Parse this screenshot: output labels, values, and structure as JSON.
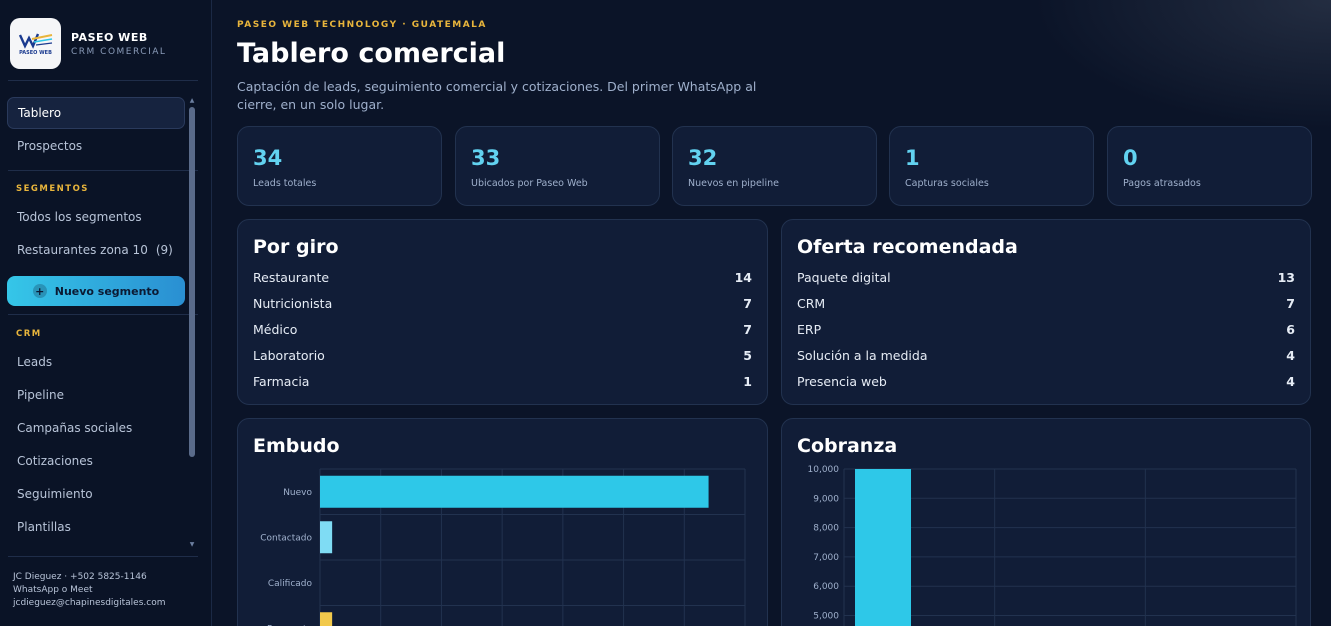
{
  "brand": {
    "name": "PASEO WEB",
    "subtitle": "CRM COMERCIAL",
    "logo_text": "PASEO WEB"
  },
  "sidebar": {
    "items_top": [
      {
        "label": "Tablero",
        "active": true
      },
      {
        "label": "Prospectos",
        "active": false
      }
    ],
    "segments_title": "SEGMENTOS",
    "segments": [
      {
        "label": "Todos los segmentos",
        "count": ""
      },
      {
        "label": "Restaurantes zona 10",
        "count": "(9)"
      }
    ],
    "new_segment_label": "Nuevo segmento",
    "crm_title": "CRM",
    "crm_items": [
      "Leads",
      "Pipeline",
      "Campañas sociales",
      "Cotizaciones",
      "Seguimiento",
      "Plantillas"
    ],
    "contact": {
      "line1": "JC Dieguez · +502 5825-1146",
      "line2": "WhatsApp o Meet",
      "line3": "jcdieguez@chapinesdigitales.com"
    }
  },
  "header": {
    "eyebrow": "PASEO WEB TECHNOLOGY · GUATEMALA",
    "title": "Tablero comercial",
    "description": "Captación de leads, seguimiento comercial y cotizaciones. Del primer WhatsApp al cierre, en un solo lugar."
  },
  "stats": [
    {
      "value": "34",
      "label": "Leads totales"
    },
    {
      "value": "33",
      "label": "Ubicados por Paseo Web"
    },
    {
      "value": "32",
      "label": "Nuevos en pipeline"
    },
    {
      "value": "1",
      "label": "Capturas sociales"
    },
    {
      "value": "0",
      "label": "Pagos atrasados"
    }
  ],
  "por_giro": {
    "title": "Por giro",
    "rows": [
      {
        "label": "Restaurante",
        "value": "14"
      },
      {
        "label": "Nutricionista",
        "value": "7"
      },
      {
        "label": "Médico",
        "value": "7"
      },
      {
        "label": "Laboratorio",
        "value": "5"
      },
      {
        "label": "Farmacia",
        "value": "1"
      }
    ]
  },
  "oferta": {
    "title": "Oferta recomendada",
    "rows": [
      {
        "label": "Paquete digital",
        "value": "13"
      },
      {
        "label": "CRM",
        "value": "7"
      },
      {
        "label": "ERP",
        "value": "6"
      },
      {
        "label": "Solución a la medida",
        "value": "4"
      },
      {
        "label": "Presencia web",
        "value": "4"
      }
    ]
  },
  "colors": {
    "accent": "#2ec8e8",
    "gold": "#e8b53c",
    "panel": "#111d37",
    "bg": "#0b1428"
  },
  "chart_data": [
    {
      "type": "bar",
      "orientation": "horizontal",
      "title": "Embudo",
      "categories": [
        "Nuevo",
        "Contactado",
        "Calificado",
        "Propuesta"
      ],
      "values": [
        32,
        1,
        0,
        1
      ],
      "colors": [
        "#2ec8e8",
        "#7fdcf4",
        "#2ec8e8",
        "#f2c94c"
      ],
      "xlim": [
        0,
        35
      ],
      "grid": true
    },
    {
      "type": "bar",
      "title": "Cobranza",
      "categories": [
        "",
        "",
        ""
      ],
      "values": [
        10000,
        0,
        0
      ],
      "yticks": [
        "10,000",
        "9,000",
        "8,000",
        "7,000",
        "6,000",
        "5,000"
      ],
      "ylim_visible": [
        5000,
        10000
      ],
      "grid": true
    }
  ]
}
